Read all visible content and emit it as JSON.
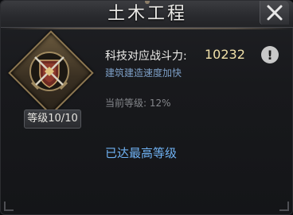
{
  "title": "土木工程",
  "tech": {
    "power_label": "科技对应战斗力:",
    "power_value": "10232",
    "description": "建筑建造速度加快",
    "current_level_label": "当前等级:",
    "current_level_value": "12%",
    "level_badge": "等级10/10",
    "max_level_text": "已达最高等级"
  },
  "icons": {
    "close": "close-icon",
    "info": "exclamation-icon",
    "emblem": "crossed-swords-shield-icon"
  },
  "colors": {
    "title_text": "#ecebe8",
    "power_value": "#f0e0a8",
    "description": "#7d9fc6",
    "max_level": "#6fb1f2",
    "current_level": "#85878c"
  }
}
